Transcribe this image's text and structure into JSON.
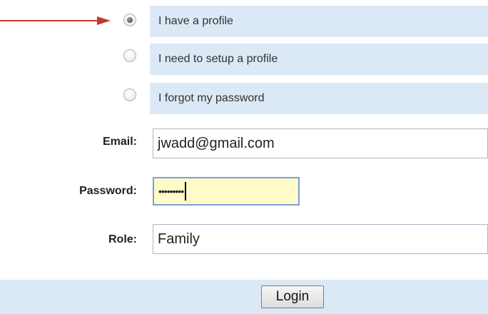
{
  "profile_options": [
    {
      "label": "I have a profile",
      "selected": true
    },
    {
      "label": "I need to setup a profile",
      "selected": false
    },
    {
      "label": "I forgot my password",
      "selected": false
    }
  ],
  "form": {
    "email_label": "Email:",
    "email_value": "jwadd@gmail.com",
    "password_label": "Password:",
    "password_masked": "•••••••••",
    "role_label": "Role:",
    "role_value": "Family"
  },
  "actions": {
    "login_label": "Login"
  },
  "colors": {
    "row_background": "#dbe8f5",
    "arrow": "#c0392b",
    "focused_field": "#fffbc8"
  }
}
